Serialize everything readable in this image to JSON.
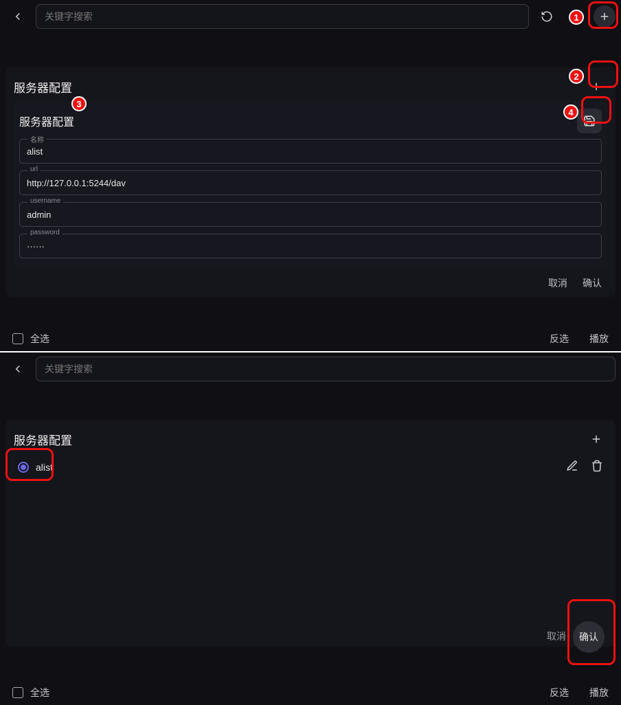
{
  "top": {
    "search_placeholder": "关键字搜索",
    "section_title": "服务器配置",
    "form_title": "服务器配置",
    "fields": {
      "name": {
        "label": "名称",
        "value": "alist"
      },
      "url": {
        "label": "url",
        "value": "http://127.0.0.1:5244/dav"
      },
      "username": {
        "label": "username",
        "value": "admin"
      },
      "password": {
        "label": "password",
        "value": "······"
      }
    },
    "cancel": "取消",
    "confirm": "确认",
    "select_all": "全选",
    "invert": "反选",
    "play": "播放",
    "callouts": {
      "1": "1",
      "2": "2",
      "3": "3",
      "4": "4"
    }
  },
  "bottom": {
    "search_placeholder": "关键字搜索",
    "section_title": "服务器配置",
    "item_label": "alist",
    "cancel": "取消",
    "confirm": "确认",
    "select_all": "全选",
    "invert": "反选",
    "play": "播放"
  }
}
